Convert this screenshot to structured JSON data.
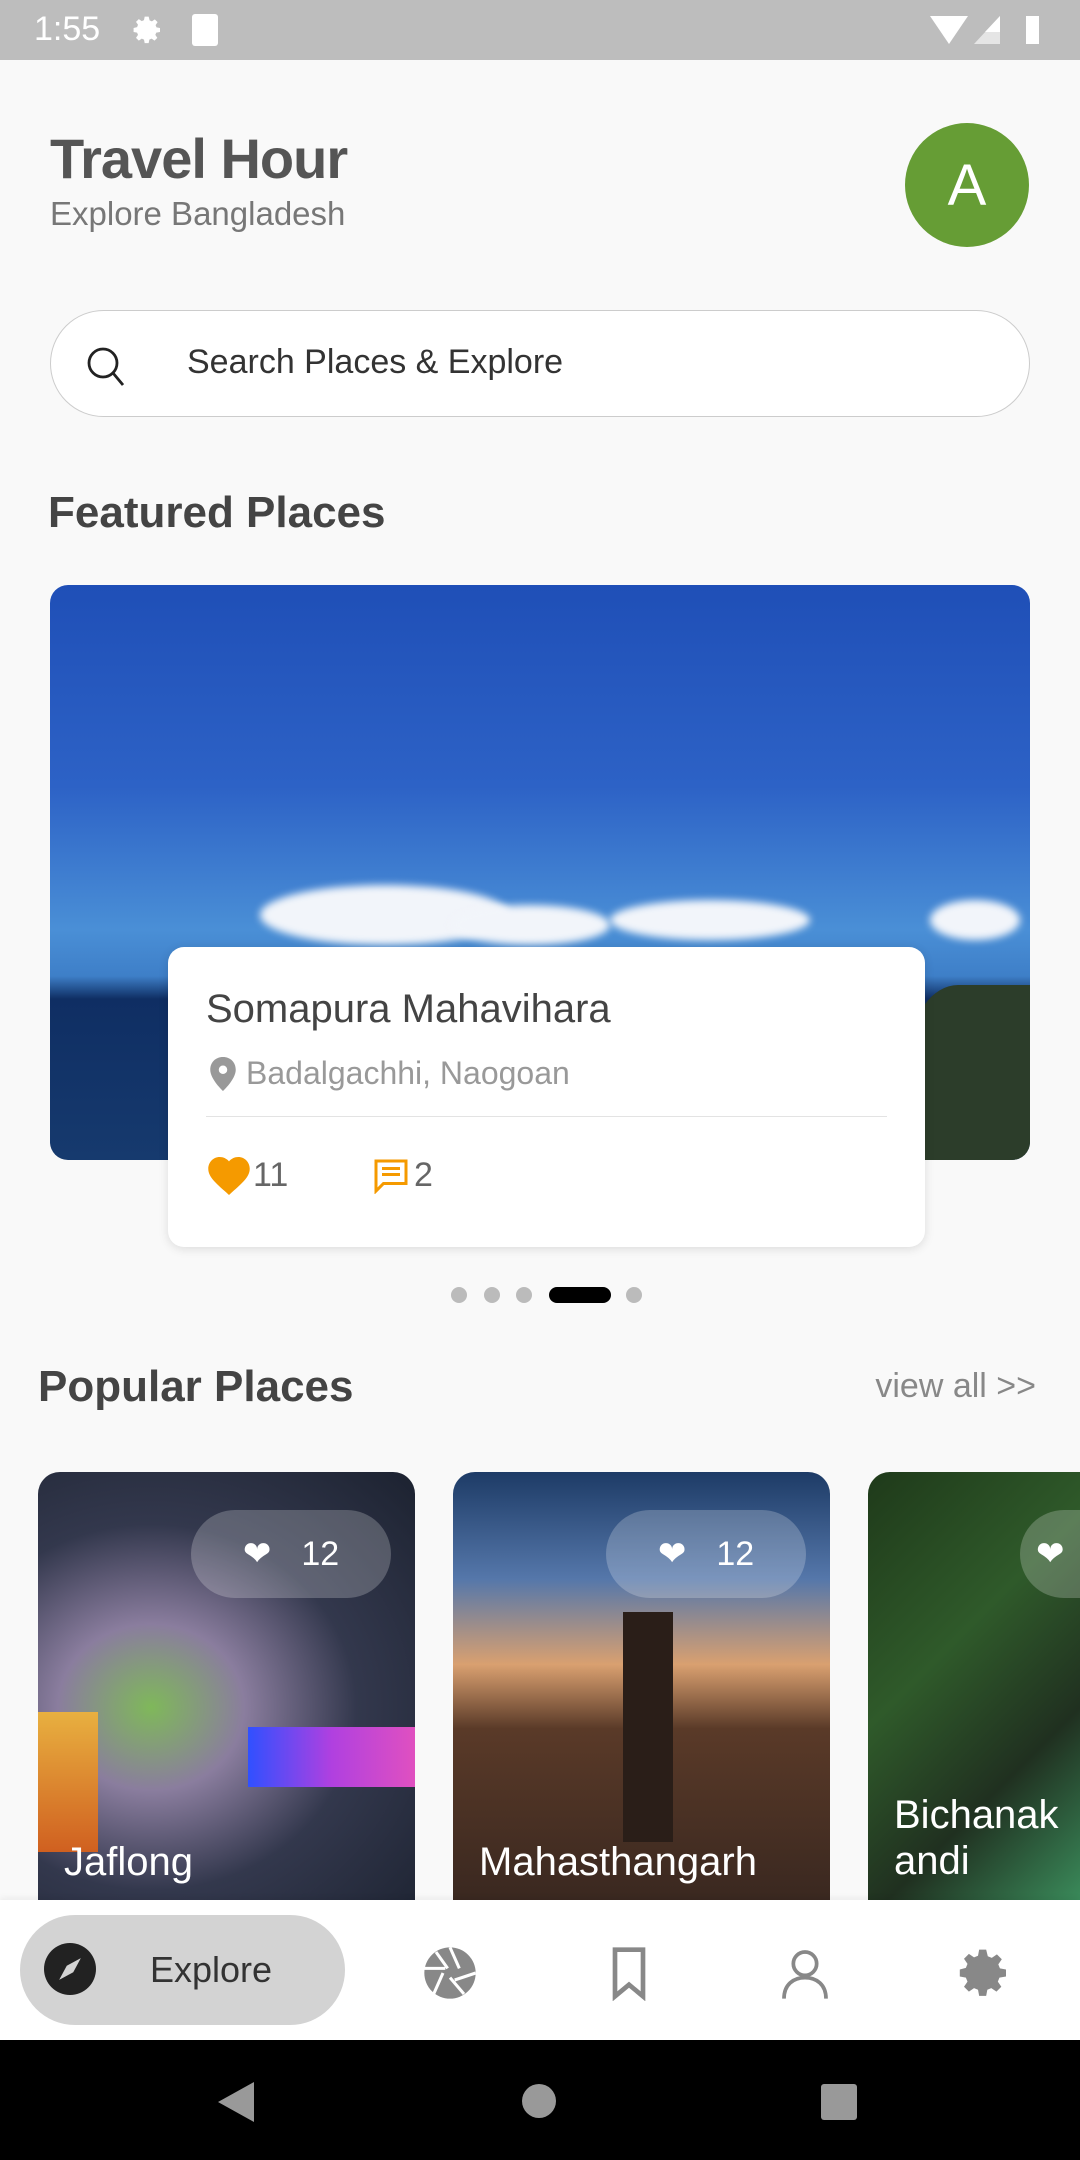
{
  "status_bar": {
    "time": "1:55"
  },
  "header": {
    "title": "Travel Hour",
    "subtitle": "Explore Bangladesh",
    "avatar_letter": "A",
    "avatar_color": "#669d35"
  },
  "search": {
    "placeholder": "Search Places & Explore"
  },
  "featured": {
    "title": "Featured Places",
    "card": {
      "name": "Somapura Mahavihara",
      "location": "Badalgachhi, Naogoan",
      "likes": "11",
      "comments": "2"
    },
    "slide_count": 5,
    "active_slide": 4
  },
  "popular": {
    "title": "Popular Places",
    "view_all": "view all >>",
    "items": [
      {
        "name": "Jaflong",
        "likes": "12"
      },
      {
        "name": "Mahasthangarh",
        "likes": "12"
      },
      {
        "name": "Bichanakandi",
        "likes": ""
      }
    ]
  },
  "bottom_nav": {
    "items": [
      {
        "label": "Explore",
        "icon": "compass-icon",
        "active": true
      },
      {
        "icon": "aperture-icon"
      },
      {
        "icon": "bookmark-icon"
      },
      {
        "icon": "profile-icon"
      },
      {
        "icon": "settings-icon"
      }
    ]
  },
  "accent_color": "#f59a00"
}
